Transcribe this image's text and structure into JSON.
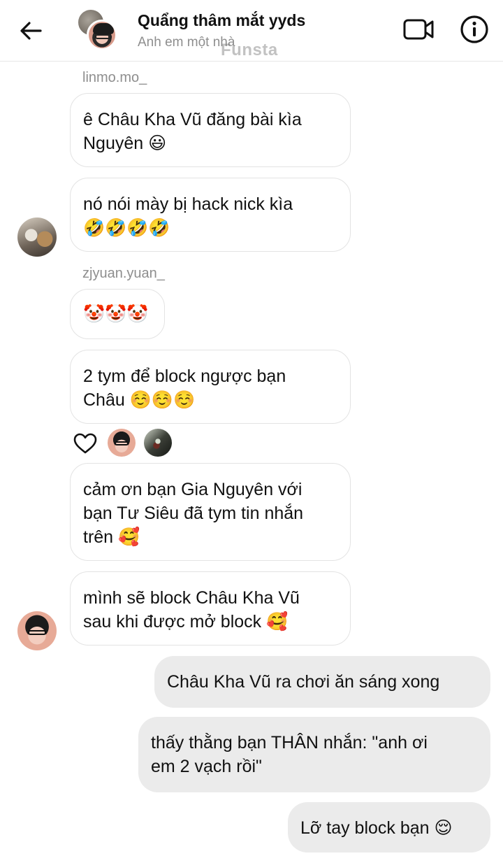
{
  "header": {
    "title": "Quẩng thâm mắt yyds",
    "subtitle": "Anh em một nhà",
    "watermark": "Funsta"
  },
  "messages": {
    "sender_1": "linmo.mo_",
    "m1": "ê Châu Kha Vũ đăng bài kìa\nNguyên 😃",
    "m2": "nó nói mày bị hack nick kìa\n🤣🤣🤣🤣",
    "sender_2": "zjyuan.yuan_",
    "m3": "🤡🤡🤡",
    "m4": "2 tym để block ngược bạn\nChâu ☺️☺️☺️",
    "m5": "cảm ơn bạn Gia Nguyên với\nbạn Tư Siêu đã tym tin nhắn\ntrên 🥰",
    "m6": "mình sẽ block Châu Kha Vũ\nsau khi được mở block 🥰",
    "out1": "Châu Kha Vũ ra chơi ăn sáng xong",
    "out2": "thấy thằng bạn THÂN nhắn: \"anh ơi\nem 2 vạch rồi\"",
    "out3": "Lỡ tay block bạn 😌"
  },
  "icons": {
    "back": "arrow-left-icon",
    "video": "video-camera-icon",
    "info": "info-icon",
    "like": "heart-outline-icon"
  }
}
